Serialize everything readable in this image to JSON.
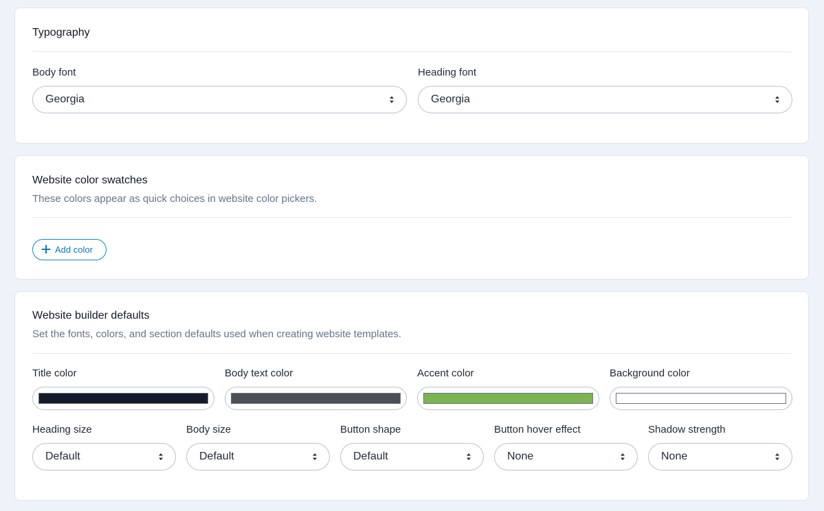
{
  "typography": {
    "title": "Typography",
    "body_font_label": "Body font",
    "body_font_value": "Georgia",
    "heading_font_label": "Heading font",
    "heading_font_value": "Georgia"
  },
  "swatches": {
    "title": "Website color swatches",
    "description": "These colors appear as quick choices in website color pickers.",
    "add_button_label": "Add color"
  },
  "builder": {
    "title": "Website builder defaults",
    "description": "Set the fonts, colors, and section defaults used when creating website templates.",
    "colors": [
      {
        "label": "Title color",
        "color": "#121a2b"
      },
      {
        "label": "Body text color",
        "color": "#4a4f58"
      },
      {
        "label": "Accent color",
        "color": "#7ab551"
      },
      {
        "label": "Background color",
        "color": "#ffffff"
      }
    ],
    "selects": [
      {
        "label": "Heading size",
        "value": "Default"
      },
      {
        "label": "Body size",
        "value": "Default"
      },
      {
        "label": "Button shape",
        "value": "Default"
      },
      {
        "label": "Button hover effect",
        "value": "None"
      },
      {
        "label": "Shadow strength",
        "value": "None"
      }
    ]
  },
  "icons": {
    "select_caret": "sort-caret-icon",
    "add": "plus-icon"
  },
  "theme": {
    "page_bg": "#eef2f9",
    "accent": "#0e7ab0"
  }
}
